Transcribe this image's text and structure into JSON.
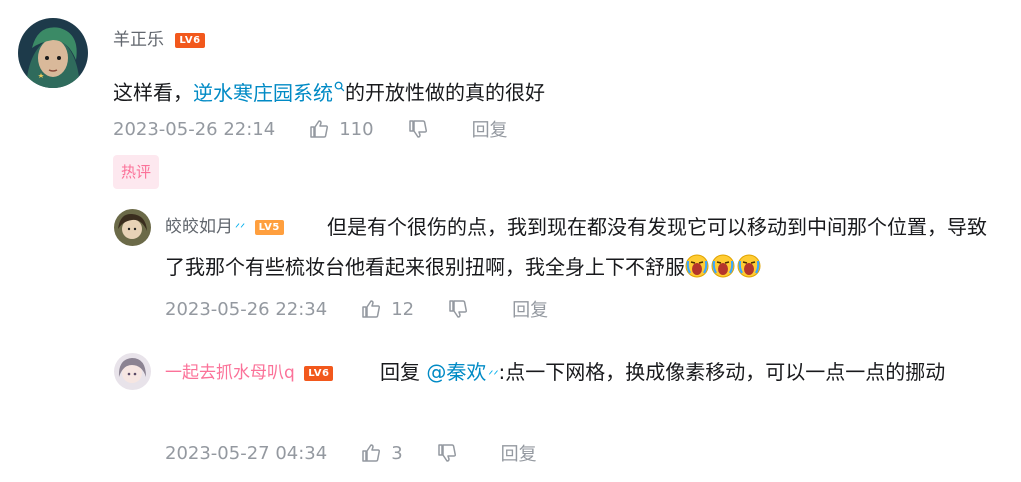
{
  "main_comment": {
    "username": "羊正乐",
    "level": "LV6",
    "content_prefix": "这样看，",
    "content_link": "逆水寒庄园系统",
    "content_suffix": "的开放性做的真的很好",
    "timestamp": "2023-05-26 22:14",
    "likes": "110",
    "reply_label": "回复",
    "hot_tag": "热评"
  },
  "replies": [
    {
      "username": "皎皎如月",
      "level": "LV5",
      "content": "但是有个很伤的点，我到现在都没有发现它可以移动到中间那个位置，导致了我那个有些梳妆台他看起来很别扭啊，我全身上下不舒服",
      "emoji": [
        "crying-emoji",
        "crying-emoji",
        "crying-emoji"
      ],
      "timestamp": "2023-05-26 22:34",
      "likes": "12",
      "reply_label": "回复"
    },
    {
      "username": "一起去抓水母叭q",
      "level": "LV6",
      "reply_prefix": "回复 ",
      "mention": "@秦欢",
      "content": ":点一下网格，换成像素移动，可以一点一点的挪动",
      "timestamp": "2023-05-27 04:34",
      "likes": "3",
      "reply_label": "回复"
    }
  ],
  "colors": {
    "link": "#008ac5",
    "meta": "#9499a0",
    "pink_name": "#fb7299",
    "level_badge": "#f2581c"
  }
}
